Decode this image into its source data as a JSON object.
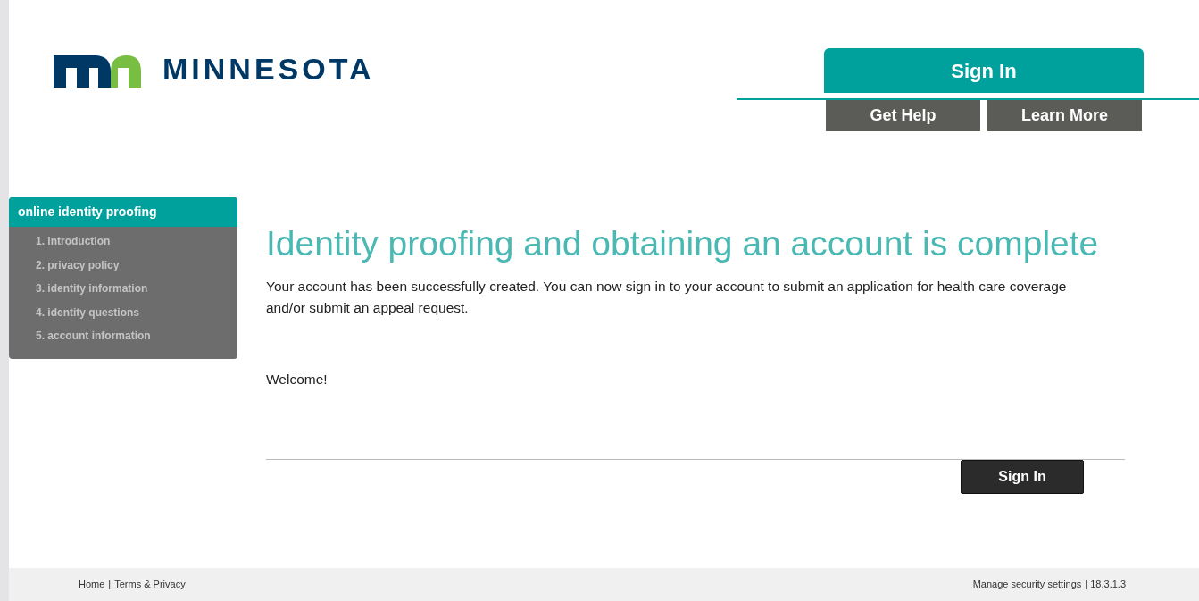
{
  "header": {
    "logo_text": "MINNESOTA",
    "sign_in_tab": "Sign In",
    "buttons": [
      "Get Help",
      "Learn More"
    ]
  },
  "sidebar": {
    "title": "online identity proofing",
    "items": [
      "1. introduction",
      "2. privacy policy",
      "3. identity information",
      "4. identity questions",
      "5. account information"
    ]
  },
  "main": {
    "heading": "Identity proofing and obtaining an account is complete",
    "message": "Your account has been successfully created. You can now sign in to your account to submit an application for health care coverage and/or submit an appeal request.",
    "welcome": "Welcome!",
    "sign_in_button": "Sign In"
  },
  "footer": {
    "left_links": [
      "Home",
      "Terms & Privacy"
    ],
    "separator": "|",
    "right_link": "Manage security settings",
    "version": "| 18.3.1.3"
  }
}
